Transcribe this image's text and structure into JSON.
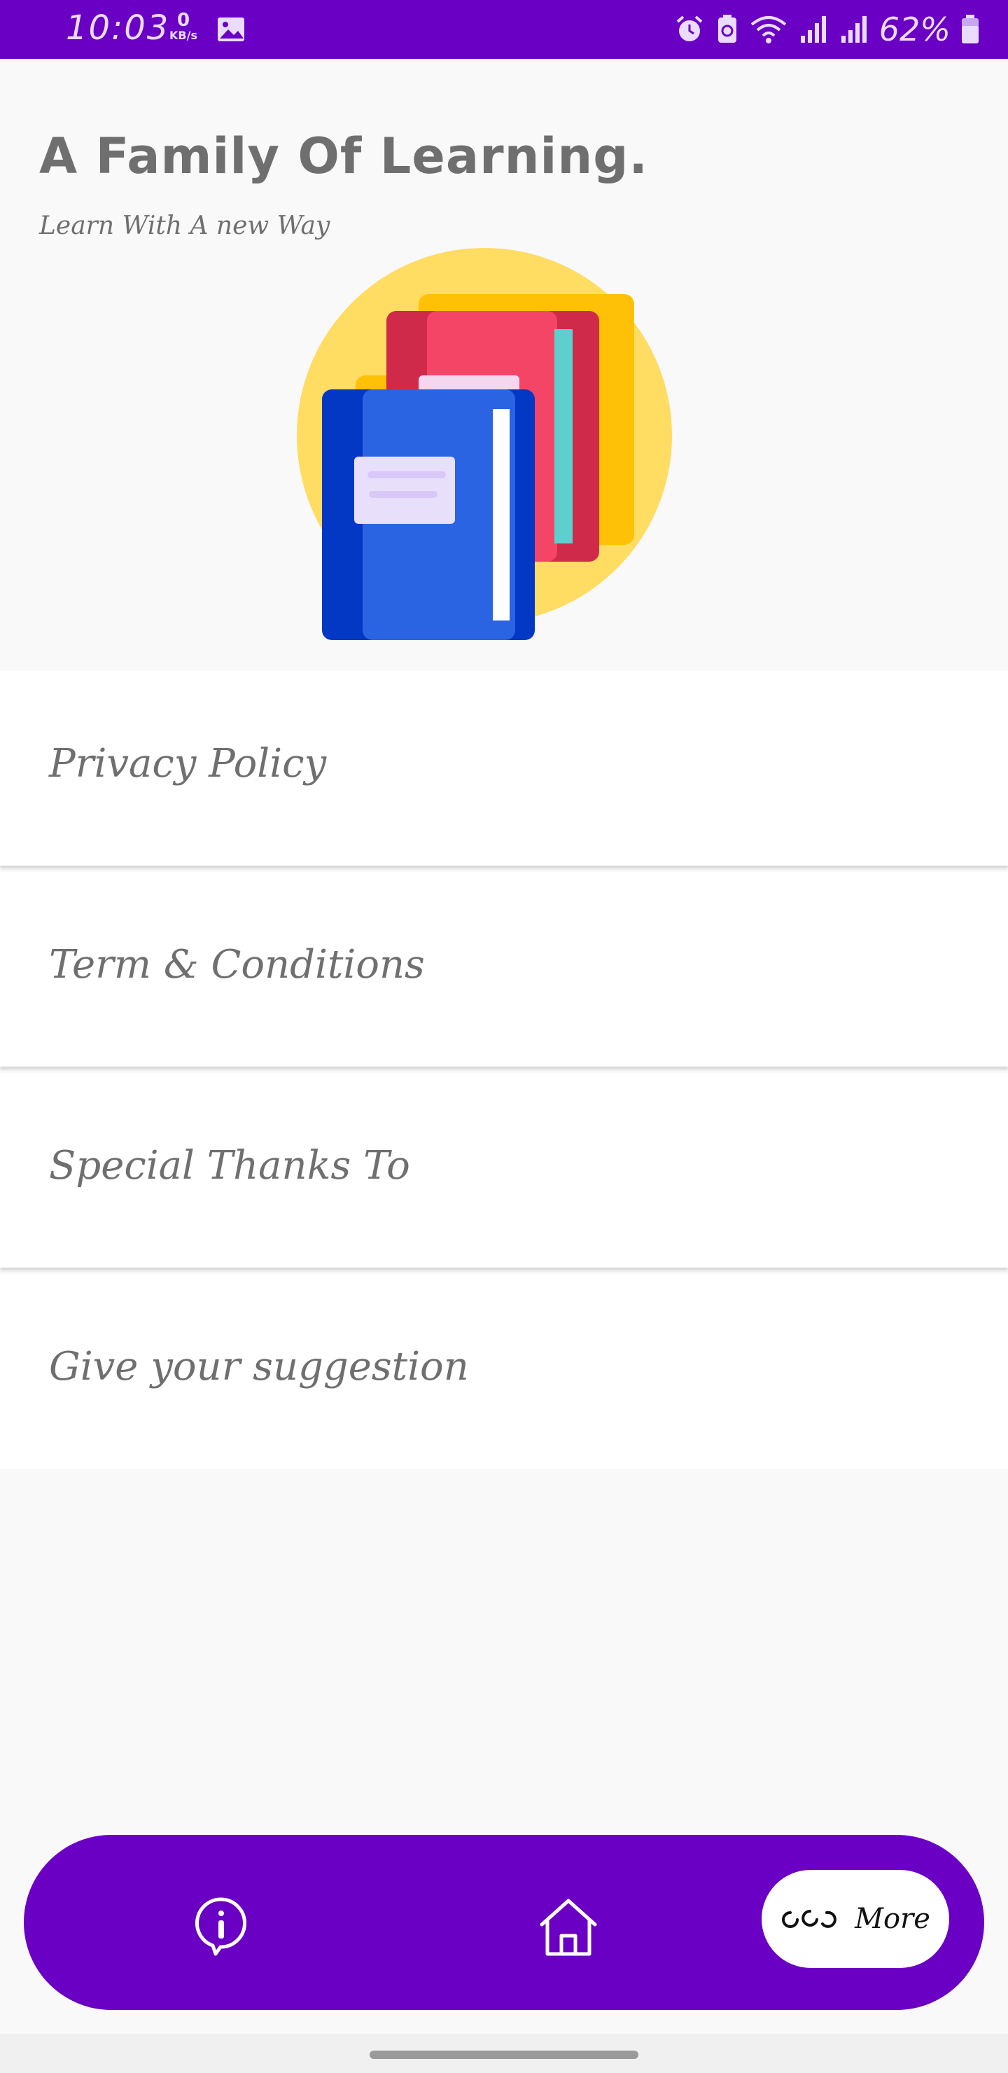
{
  "status_bar": {
    "time": "10:03",
    "net_speed_value": "0",
    "net_speed_unit": "KB/s",
    "battery_percent": "62%",
    "background": "#6a00c4"
  },
  "header": {
    "title": "A Family Of Learning.",
    "subtitle": "Learn With A new Way",
    "hero_image_icon": "books-illustration-icon"
  },
  "menu": {
    "items": [
      {
        "label": "Privacy Policy"
      },
      {
        "label": "Term & Conditions"
      },
      {
        "label": "Special Thanks To"
      },
      {
        "label": "Give your suggestion"
      }
    ]
  },
  "bottom_nav": {
    "info_icon": "info-icon",
    "home_icon": "home-icon",
    "more_icon": "more-dots-icon",
    "more_label": "More",
    "background": "#6a00c4",
    "active_item": "More"
  }
}
